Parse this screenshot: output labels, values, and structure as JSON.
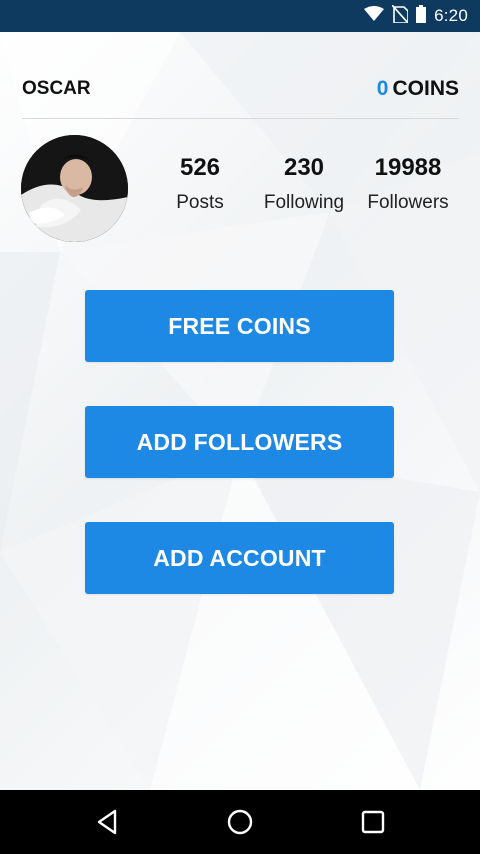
{
  "status_bar": {
    "time": "6:20",
    "icons": [
      "wifi-icon",
      "no-sim-icon",
      "battery-icon"
    ]
  },
  "header": {
    "username": "OSCAR",
    "coin_count": "0",
    "coins_label": "COINS"
  },
  "profile": {
    "avatar": "avatar-photo",
    "stats": [
      {
        "value": "526",
        "label": "Posts"
      },
      {
        "value": "230",
        "label": "Following"
      },
      {
        "value": "19988",
        "label": "Followers"
      }
    ]
  },
  "actions": {
    "free_coins": "FREE COINS",
    "add_followers": "ADD FOLLOWERS",
    "add_account": "ADD ACCOUNT"
  },
  "colors": {
    "accent": "#1e88e5",
    "status_bar": "#0f3a5f",
    "nav_bar": "#000000"
  },
  "nav_bar": {
    "buttons": [
      "back-icon",
      "home-icon",
      "recents-icon"
    ]
  }
}
